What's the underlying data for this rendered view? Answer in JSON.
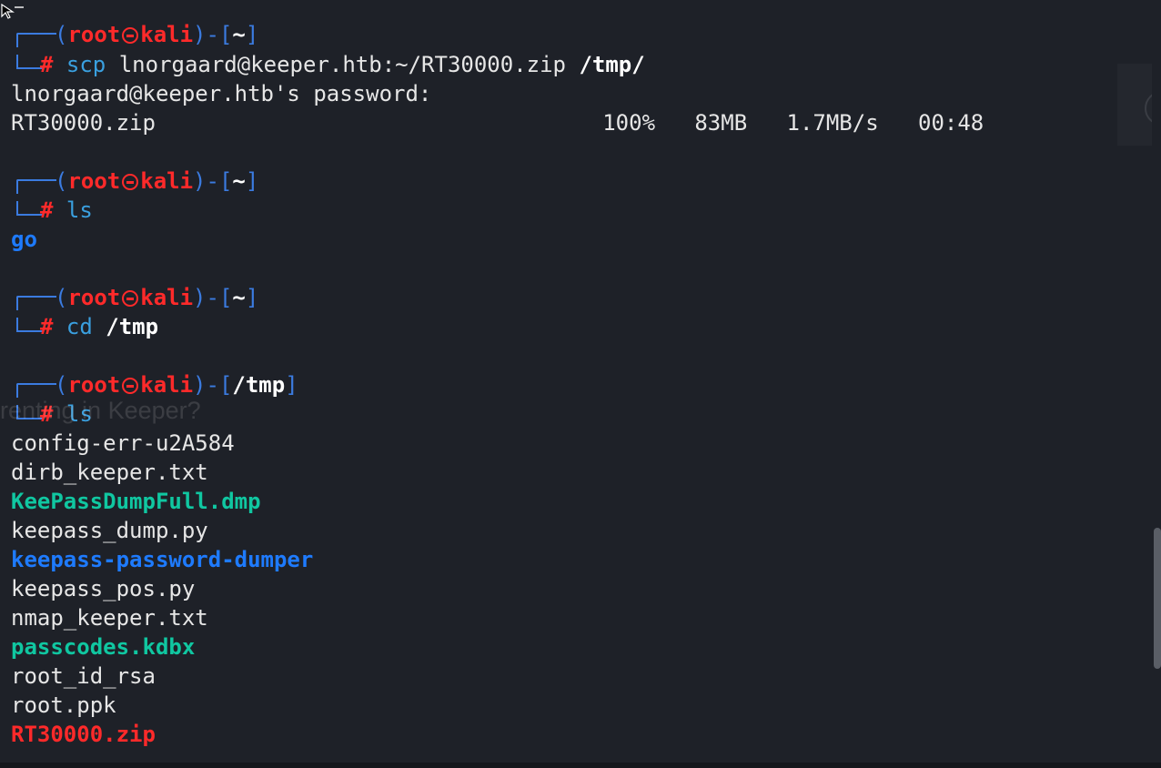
{
  "prompt": {
    "open": "(",
    "user": "root",
    "host": "kali",
    "mid": ")-[",
    "close": "]",
    "hash": "#"
  },
  "blocks": [
    {
      "dir": "~",
      "cmd": "scp",
      "args": " lnorgaard@keeper.htb:~/RT30000.zip ",
      "args_bold": "/tmp/",
      "output": [
        "lnorgaard@keeper.htb's password:",
        "RT30000.zip                                  100%   83MB   1.7MB/s   00:48"
      ]
    },
    {
      "dir": "~",
      "cmd": "ls",
      "args": "",
      "args_bold": "",
      "output_dir": "go"
    },
    {
      "dir": "~",
      "cmd": "cd",
      "args": " ",
      "args_bold": "/tmp"
    },
    {
      "dir": "/tmp",
      "cmd": "ls",
      "args": "",
      "args_bold": ""
    }
  ],
  "listing": [
    {
      "name": "config-err-u2A584",
      "kind": "file"
    },
    {
      "name": "dirb_keeper.txt",
      "kind": "file"
    },
    {
      "name": "KeePassDumpFull.dmp",
      "kind": "special"
    },
    {
      "name": "keepass_dump.py",
      "kind": "file"
    },
    {
      "name": "keepass-password-dumper",
      "kind": "dir"
    },
    {
      "name": "keepass_pos.py",
      "kind": "file"
    },
    {
      "name": "nmap_keeper.txt",
      "kind": "file"
    },
    {
      "name": "passcodes.kdbx",
      "kind": "special"
    },
    {
      "name": "root_id_rsa",
      "kind": "file"
    },
    {
      "name": "root.ppk",
      "kind": "file"
    },
    {
      "name": "RT30000.zip",
      "kind": "archive"
    }
  ],
  "overlay_text": "renting in Keeper?",
  "colors": {
    "background": "#1e2128",
    "prompt_frame": "#3b7be0",
    "prompt_user": "#ff2a2a",
    "command": "#3aa0e0",
    "directory": "#1e7bff",
    "special_file": "#10c7a1",
    "archive": "#ff2a2a"
  }
}
